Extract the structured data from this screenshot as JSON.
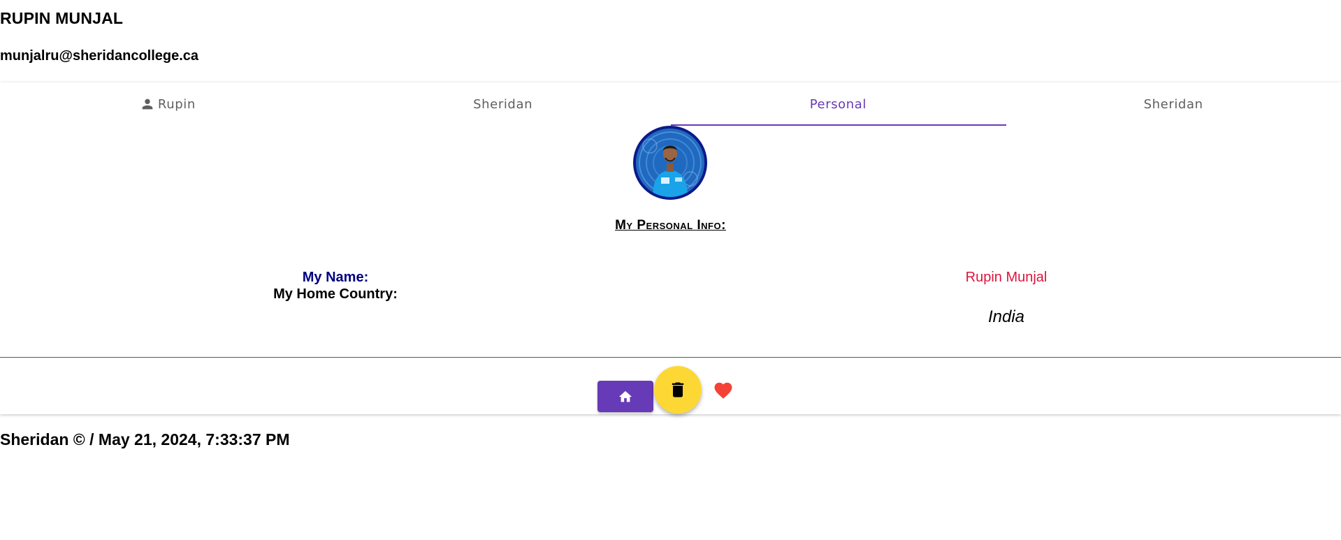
{
  "header": {
    "name": "RUPIN MUNJAL",
    "email": "munjalru@sheridancollege.ca"
  },
  "tabs": [
    {
      "label": "Rupin",
      "icon": "person-icon",
      "active": false
    },
    {
      "label": "Sheridan",
      "active": false
    },
    {
      "label": "Personal",
      "active": true
    },
    {
      "label": "Sheridan",
      "active": false
    }
  ],
  "personal": {
    "title": "My Personal Info:",
    "name_label": "My Name:",
    "name_value": "Rupin Munjal",
    "country_label": "My Home Country:",
    "country_value": "India"
  },
  "actions": {
    "home_icon": "home-icon",
    "delete_icon": "trash-icon",
    "favorite_icon": "heart-icon"
  },
  "colors": {
    "accent": "#673ab7",
    "fab": "#fdd835",
    "name_label": "#000080",
    "name_value": "#dc143c",
    "heart": "#f44336"
  },
  "footer": {
    "text": "Sheridan © / May 21, 2024, 7:33:37 PM"
  }
}
